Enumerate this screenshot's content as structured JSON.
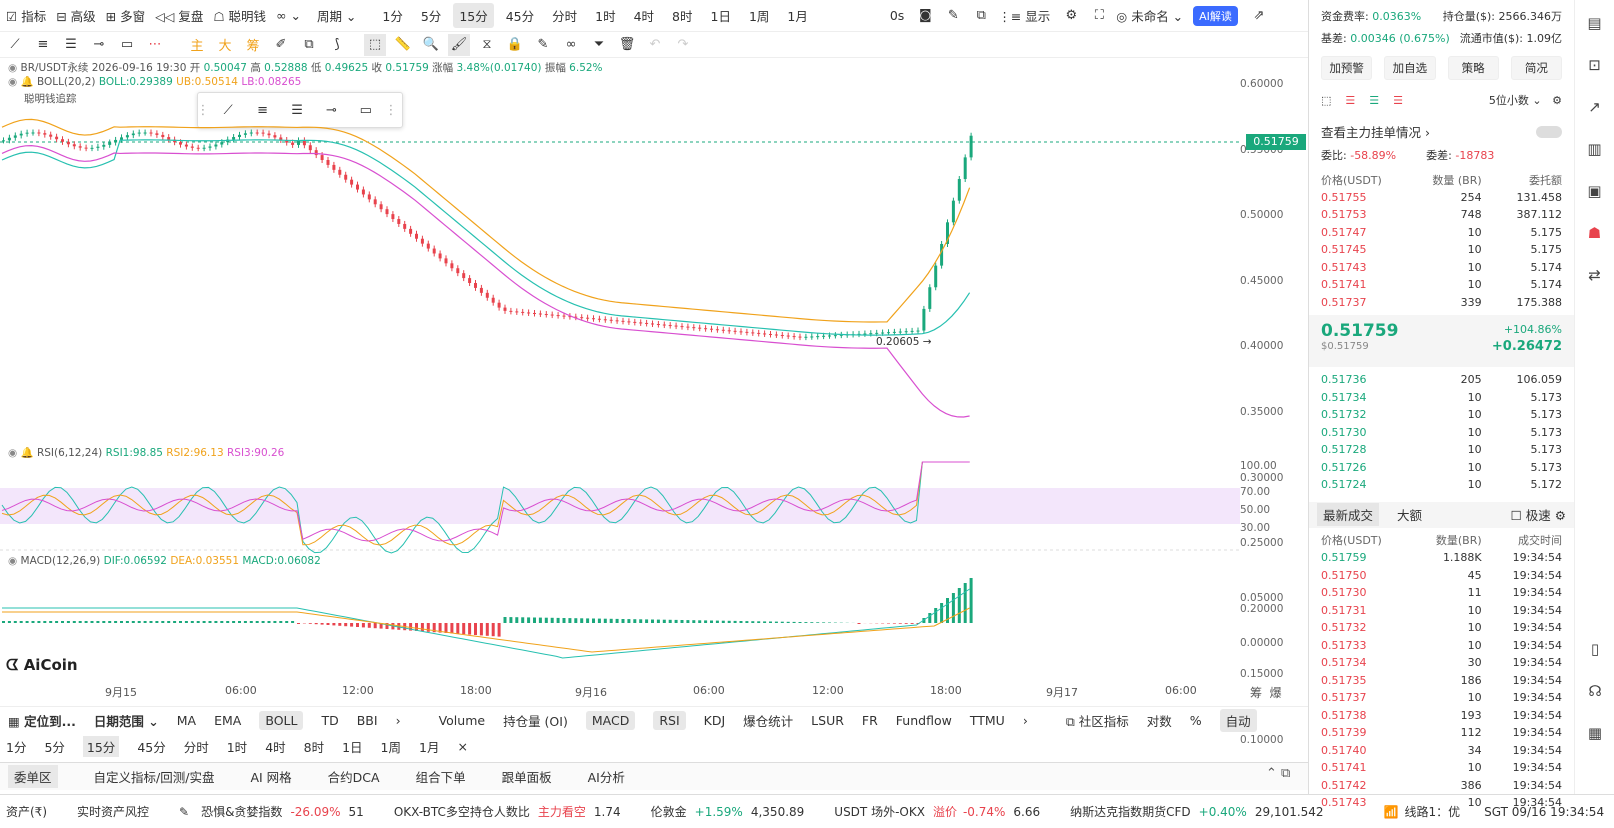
{
  "top_toolbar": {
    "indicators": "指标",
    "advanced": "高级",
    "multi_window": "多窗",
    "replay": "复盘",
    "smart_money": "聪明钱",
    "period": "周期",
    "periods": [
      "1分",
      "5分",
      "15分",
      "45分",
      "分时",
      "1时",
      "4时",
      "8时",
      "1日",
      "1周",
      "1月"
    ],
    "active_period": "15分",
    "countdown": "0s",
    "display": "显示",
    "unnamed": "未命名",
    "ai_read": "AI解读"
  },
  "symbol_info": {
    "symbol": "BR/USDT永续",
    "datetime": "2026-09-16 19:30",
    "open_label": "开",
    "open": "0.50047",
    "high_label": "高",
    "high": "0.52888",
    "low_label": "低",
    "low": "0.49625",
    "close_label": "收",
    "close": "0.51759",
    "change_label": "涨幅",
    "change": "3.48%(0.01740)",
    "amp_label": "振幅",
    "amp": "6.52%"
  },
  "boll": {
    "name": "BOLL(20,2)",
    "boll": "BOLL:0.29389",
    "ub": "UB:0.50514",
    "lb": "LB:0.08265"
  },
  "smart_track": "聪明钱追踪",
  "price_axis": [
    "0.60000",
    "0.55000",
    "0.50000",
    "0.45000",
    "0.40000",
    "0.35000",
    "0.30000",
    "0.25000",
    "0.20000",
    "0.15000",
    "0.10000"
  ],
  "current_price": "0.51759",
  "low_marker": "0.20605",
  "rsi": {
    "name": "RSI(6,12,24)",
    "rsi1": "RSI1:98.85",
    "rsi2": "RSI2:96.13",
    "rsi3": "RSI3:90.26",
    "axis": [
      "100.00",
      "70.00",
      "50.00",
      "30.00"
    ]
  },
  "macd": {
    "name": "MACD(12,26,9)",
    "dif": "DIF:0.06592",
    "dea": "DEA:0.03551",
    "macd": "MACD:0.06082",
    "axis": [
      "0.05000",
      "0.00000"
    ]
  },
  "logo": "AiCoin",
  "time_axis": [
    "9月15",
    "06:00",
    "12:00",
    "18:00",
    "9月16",
    "06:00",
    "12:00",
    "18:00",
    "9月17",
    "06:00"
  ],
  "time_axis_right": [
    "筹",
    "爆"
  ],
  "indicator_bar": {
    "locate": "定位到...",
    "date_range": "日期范围",
    "main": [
      "MA",
      "EMA",
      "BOLL",
      "TD",
      "BBI"
    ],
    "active_main": "BOLL",
    "sub": [
      "Volume",
      "持仓量 (OI)",
      "MACD",
      "RSI",
      "KDJ",
      "爆仓统计",
      "LSUR",
      "FR",
      "Fundflow",
      "TTMU"
    ],
    "active_sub": [
      "MACD",
      "RSI"
    ],
    "community": "社区指标",
    "log": "对数",
    "pct": "%",
    "auto": "自动"
  },
  "period_bar": [
    "1分",
    "5分",
    "15分",
    "45分",
    "分时",
    "1时",
    "4时",
    "8时",
    "1日",
    "1周",
    "1月"
  ],
  "period_bar_active": "15分",
  "bottom_tabs": [
    "委单区",
    "自定义指标/回测/实盘",
    "AI 网格",
    "合约DCA",
    "组合下单",
    "跟单面板",
    "AI分析"
  ],
  "status": {
    "asset": "资产(₹)",
    "risk": "实时资产风控",
    "fear_label": "恐惧&贪婪指数",
    "fear_pct": "-26.09%",
    "fear_val": "51",
    "okx_label": "OKX-BTC多空持仓人数比",
    "okx_tag": "主力看空",
    "okx_val": "1.74",
    "gold_label": "伦敦金",
    "gold_pct": "+1.59%",
    "gold_val": "4,350.89",
    "usdt_label": "USDT 场外-OKX",
    "usdt_tag": "溢价",
    "usdt_pct": "-0.74%",
    "usdt_val": "6.66",
    "nasdaq_label": "纳斯达克指数期货CFD",
    "nasdaq_pct": "+0.40%",
    "nasdaq_val": "29,101.542",
    "line": "线路1：优",
    "time": "SGT 09/16 19:34:54"
  },
  "right_panel": {
    "funding_label": "资金费率:",
    "funding": "0.0363%",
    "oi_label": "持仓量($):",
    "oi": "2566.346万",
    "basis_label": "基差:",
    "basis": "0.00346 (0.675%)",
    "mcap_label": "流通市值($):",
    "mcap": "1.09亿",
    "buttons": [
      "加预警",
      "加自选",
      "策略",
      "简况"
    ],
    "decimals": "5位小数",
    "main_orders": "查看主力挂单情况",
    "ratio_label": "委比:",
    "ratio": "-58.89%",
    "diff_label": "委差:",
    "diff": "-18783",
    "ob_headers": [
      "价格(USDT)",
      "数量 (BR)",
      "委托额"
    ],
    "asks": [
      [
        "0.51755",
        "254",
        "131.458"
      ],
      [
        "0.51753",
        "748",
        "387.112"
      ],
      [
        "0.51747",
        "10",
        "5.175"
      ],
      [
        "0.51745",
        "10",
        "5.175"
      ],
      [
        "0.51743",
        "10",
        "5.174"
      ],
      [
        "0.51741",
        "10",
        "5.174"
      ],
      [
        "0.51737",
        "339",
        "175.388"
      ]
    ],
    "last_price": "0.51759",
    "last_sub": "$0.51759",
    "chg_pct": "+104.86%",
    "chg_abs": "+0.26472",
    "bids": [
      [
        "0.51736",
        "205",
        "106.059"
      ],
      [
        "0.51734",
        "10",
        "5.173"
      ],
      [
        "0.51732",
        "10",
        "5.173"
      ],
      [
        "0.51730",
        "10",
        "5.173"
      ],
      [
        "0.51728",
        "10",
        "5.173"
      ],
      [
        "0.51726",
        "10",
        "5.173"
      ],
      [
        "0.51724",
        "10",
        "5.172"
      ]
    ],
    "trades_tab": "最新成交",
    "large_tab": "大额",
    "fast": "极速",
    "trade_headers": [
      "价格(USDT)",
      "数量(BR)",
      "成交时间"
    ],
    "trades": [
      [
        "0.51759",
        "1.188K",
        "19:34:54",
        "g"
      ],
      [
        "0.51750",
        "45",
        "19:34:54",
        "r"
      ],
      [
        "0.51730",
        "11",
        "19:34:54",
        "r"
      ],
      [
        "0.51731",
        "10",
        "19:34:54",
        "r"
      ],
      [
        "0.51732",
        "10",
        "19:34:54",
        "r"
      ],
      [
        "0.51733",
        "10",
        "19:34:54",
        "r"
      ],
      [
        "0.51734",
        "30",
        "19:34:54",
        "r"
      ],
      [
        "0.51735",
        "186",
        "19:34:54",
        "r"
      ],
      [
        "0.51737",
        "10",
        "19:34:54",
        "r"
      ],
      [
        "0.51738",
        "193",
        "19:34:54",
        "r"
      ],
      [
        "0.51739",
        "112",
        "19:34:54",
        "r"
      ],
      [
        "0.51740",
        "34",
        "19:34:54",
        "r"
      ],
      [
        "0.51741",
        "10",
        "19:34:54",
        "r"
      ],
      [
        "0.51742",
        "386",
        "19:34:54",
        "r"
      ],
      [
        "0.51743",
        "10",
        "19:34:54",
        "r"
      ]
    ]
  }
}
